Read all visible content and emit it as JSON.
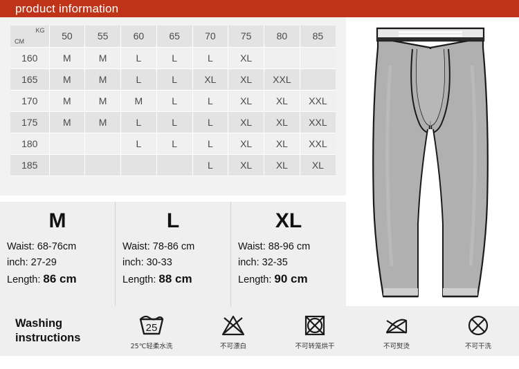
{
  "header": {
    "title": "product information"
  },
  "size_table": {
    "corner": {
      "kg_label": "KG",
      "cm_label": "CM"
    },
    "weights": [
      "50",
      "55",
      "60",
      "65",
      "70",
      "75",
      "80",
      "85"
    ],
    "rows": [
      {
        "height": "160",
        "sizes": [
          "M",
          "M",
          "L",
          "L",
          "L",
          "XL",
          "",
          ""
        ]
      },
      {
        "height": "165",
        "sizes": [
          "M",
          "M",
          "L",
          "L",
          "XL",
          "XL",
          "XXL",
          ""
        ]
      },
      {
        "height": "170",
        "sizes": [
          "M",
          "M",
          "M",
          "L",
          "L",
          "XL",
          "XL",
          "XXL"
        ]
      },
      {
        "height": "175",
        "sizes": [
          "M",
          "M",
          "L",
          "L",
          "L",
          "XL",
          "XL",
          "XXL"
        ]
      },
      {
        "height": "180",
        "sizes": [
          "",
          "",
          "L",
          "L",
          "L",
          "XL",
          "XL",
          "XXL"
        ]
      },
      {
        "height": "185",
        "sizes": [
          "",
          "",
          "",
          "",
          "L",
          "XL",
          "XL",
          "XL"
        ]
      }
    ]
  },
  "size_details": [
    {
      "letter": "M",
      "waist_label": "Waist:",
      "waist_value": "68-76cm",
      "inch_label": "inch:",
      "inch_value": "27-29",
      "length_label": "Length:",
      "length_value": "86 cm"
    },
    {
      "letter": "L",
      "waist_label": "Waist:",
      "waist_value": "78-86 cm",
      "inch_label": "inch:",
      "inch_value": "30-33",
      "length_label": "Length:",
      "length_value": "88 cm"
    },
    {
      "letter": "XL",
      "waist_label": "Waist:",
      "waist_value": "88-96 cm",
      "inch_label": "inch:",
      "inch_value": "32-35",
      "length_label": "Length:",
      "length_value": "90 cm"
    }
  ],
  "washing": {
    "title_line1": "Washing",
    "title_line2": "instructions",
    "symbols": [
      {
        "icon": "wash-tub-25-icon",
        "temperature": "25",
        "caption": "25℃轻柔水洗"
      },
      {
        "icon": "do-not-bleach-icon",
        "caption": "不可漂白"
      },
      {
        "icon": "do-not-tumble-dry-icon",
        "caption": "不可转笼烘干"
      },
      {
        "icon": "do-not-iron-icon",
        "caption": "不可熨烫"
      },
      {
        "icon": "do-not-dry-clean-icon",
        "caption": "不可干洗"
      }
    ]
  },
  "product_image": {
    "alt": "long-johns-leggings-illustration"
  },
  "colors": {
    "header_red": "#bf3318",
    "panel_gray": "#efefef",
    "table_row_light": "#f0f0f0",
    "table_row_dark": "#e3e3e3",
    "garment_fill": "#b0b0b0",
    "garment_outline": "#1a1a1a"
  }
}
